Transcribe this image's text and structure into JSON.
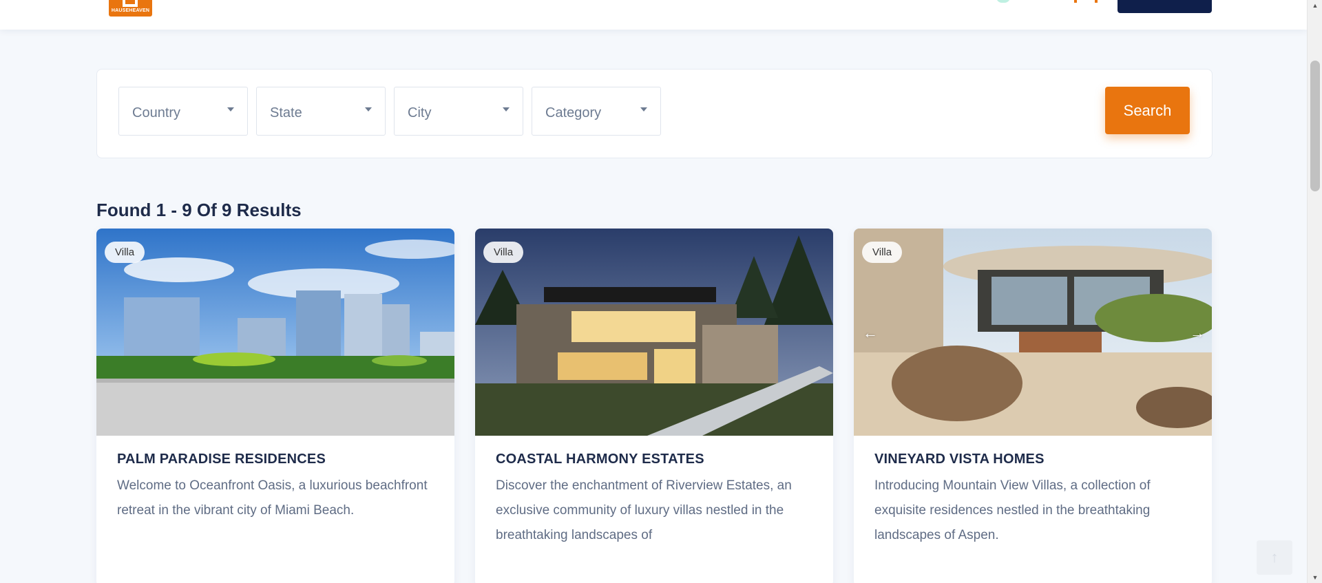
{
  "header": {
    "logo_text": "HAUSEHEAVEN"
  },
  "filters": {
    "country": "Country",
    "state": "State",
    "city": "City",
    "category": "Category",
    "search_label": "Search"
  },
  "results": {
    "title": "Found 1 - 9 Of 9 Results"
  },
  "cards": [
    {
      "badge": "Villa",
      "title": "PALM PARADISE RESIDENCES",
      "description": "Welcome to Oceanfront Oasis, a luxurious beachfront retreat in the vibrant city of Miami Beach."
    },
    {
      "badge": "Villa",
      "title": "COASTAL HARMONY ESTATES",
      "description": "Discover the enchantment of Riverview Estates, an exclusive community of luxury villas nestled in the breathtaking landscapes of"
    },
    {
      "badge": "Villa",
      "title": "VINEYARD VISTA HOMES",
      "description": "Introducing Mountain View Villas, a collection of exquisite residences nestled in the breathtaking landscapes of Aspen."
    }
  ],
  "colors": {
    "accent": "#e9750f",
    "navy": "#0f1f4b",
    "background": "#f5f8fc"
  },
  "icons": {
    "carousel_prev": "arrow-left-icon",
    "carousel_next": "arrow-right-icon",
    "back_to_top": "arrow-up-icon"
  }
}
